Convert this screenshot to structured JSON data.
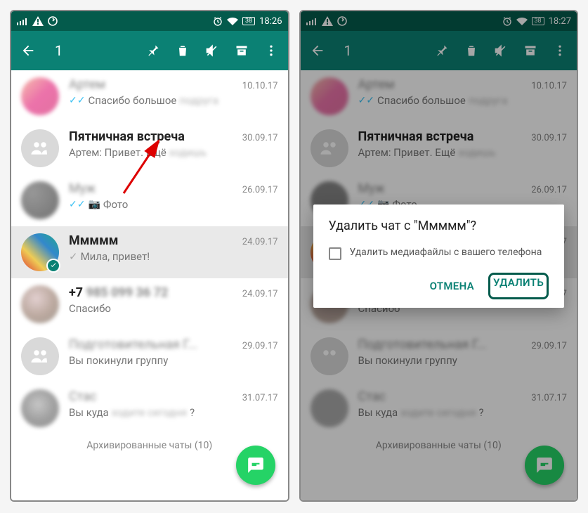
{
  "status": {
    "battery": "38",
    "time_left": "18:26",
    "time_right": "18:27"
  },
  "appbar": {
    "selected_count": "1"
  },
  "chats": [
    {
      "name": "Артем",
      "date": "10.10.17",
      "msg": "Спасибо большое",
      "ticks": true,
      "bold": false,
      "blurred_name": true,
      "avatar_style": "pink"
    },
    {
      "name": "Пятничная встреча",
      "date": "30.09.17",
      "msg": "Артем: Привет. Ещё",
      "ticks": false,
      "bold": true,
      "avatar_style": "placeholder"
    },
    {
      "name": "Муж",
      "date": "26.09.17",
      "msg": "Фото",
      "ticks": true,
      "camera": true,
      "bold": false,
      "blurred_name": true,
      "avatar_style": "dark"
    },
    {
      "name": "Ммммм",
      "date": "24.09.17",
      "msg": "Мила, привет!",
      "ticks": false,
      "sent_gray": true,
      "bold": true,
      "selected": true,
      "avatar_style": "mixed"
    },
    {
      "name": "+7",
      "date": "24.09.17",
      "msg": "Спасибо",
      "bold": true,
      "blurred_rest": true,
      "avatar_style": "brown"
    },
    {
      "name": "Подготовительная Г...",
      "date": "29.09.17",
      "msg": "Вы покинули группу",
      "blurred_name": true,
      "avatar_style": "placeholder"
    },
    {
      "name": "Стас",
      "date": "31.07.17",
      "msg": "Вы куда",
      "blurred_name": true,
      "avatar_style": "gray",
      "tail": "?"
    }
  ],
  "archived_label": "Архивированные чаты (10)",
  "dialog": {
    "title": "Удалить чат с \"Ммммм\"?",
    "checkbox_label": "Удалить медиафайлы с вашего телефона",
    "cancel": "ОТМЕНА",
    "confirm": "УДАЛИТЬ"
  }
}
